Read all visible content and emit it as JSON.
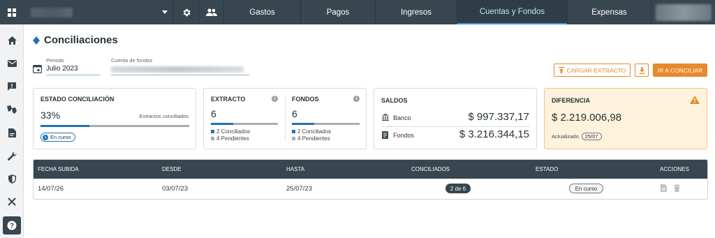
{
  "topbar": {
    "tabs": [
      {
        "label": "Gastos"
      },
      {
        "label": "Pagos"
      },
      {
        "label": "Ingresos"
      },
      {
        "label": "Cuentas y Fondos"
      },
      {
        "label": "Expensas"
      }
    ],
    "active_tab": "Cuentas y Fondos"
  },
  "page": {
    "title": "Conciliaciones"
  },
  "filters": {
    "periodo_label": "Periodo",
    "periodo_value": "Julio 2023",
    "cuenta_label": "Cuenta de fondos"
  },
  "actions": {
    "cargar_label": "CARGAR EXTRACTO",
    "conciliar_label": "IR A CONCILIAR"
  },
  "estado": {
    "title": "ESTADO CONCILIACIÓN",
    "percent_text": "33%",
    "percent_value": 33,
    "caption": "Extractos conciliados",
    "badge": "En curso"
  },
  "extracto": {
    "title": "EXTRACTO",
    "count": "6",
    "progress": 0.33,
    "conciliados": "2 Conciliados",
    "pendientes": "4 Pendientes"
  },
  "fondos": {
    "title": "FONDOS",
    "count": "6",
    "progress": 0.33,
    "conciliados": "2 Conciliados",
    "pendientes": "4 Pendientes"
  },
  "saldos": {
    "title": "SALDOS",
    "banco_label": "Banco",
    "banco_value": "$ 997.337,17",
    "fondos_label": "Fondos",
    "fondos_value": "$ 3.216.344,15"
  },
  "diferencia": {
    "title": "DIFERENCIA",
    "value": "$ 2.219.006,98",
    "updated_label": "Actualizado",
    "updated_date": "25/07"
  },
  "table": {
    "headers": [
      "FECHA SUBIDA",
      "DESDE",
      "HASTA",
      "CONCILIADOS",
      "ESTADO",
      "ACCIONES"
    ],
    "rows": [
      {
        "fecha_subida": "14/07/26",
        "desde": "03/07/23",
        "hasta": "25/07/23",
        "conciliados": "2 de 6",
        "estado": "En curso"
      }
    ]
  },
  "colors": {
    "topbar": "#37464f",
    "accent_orange": "#e8892b",
    "progress_blue": "#1d73b8",
    "warning_bg": "#fdf2dc"
  }
}
